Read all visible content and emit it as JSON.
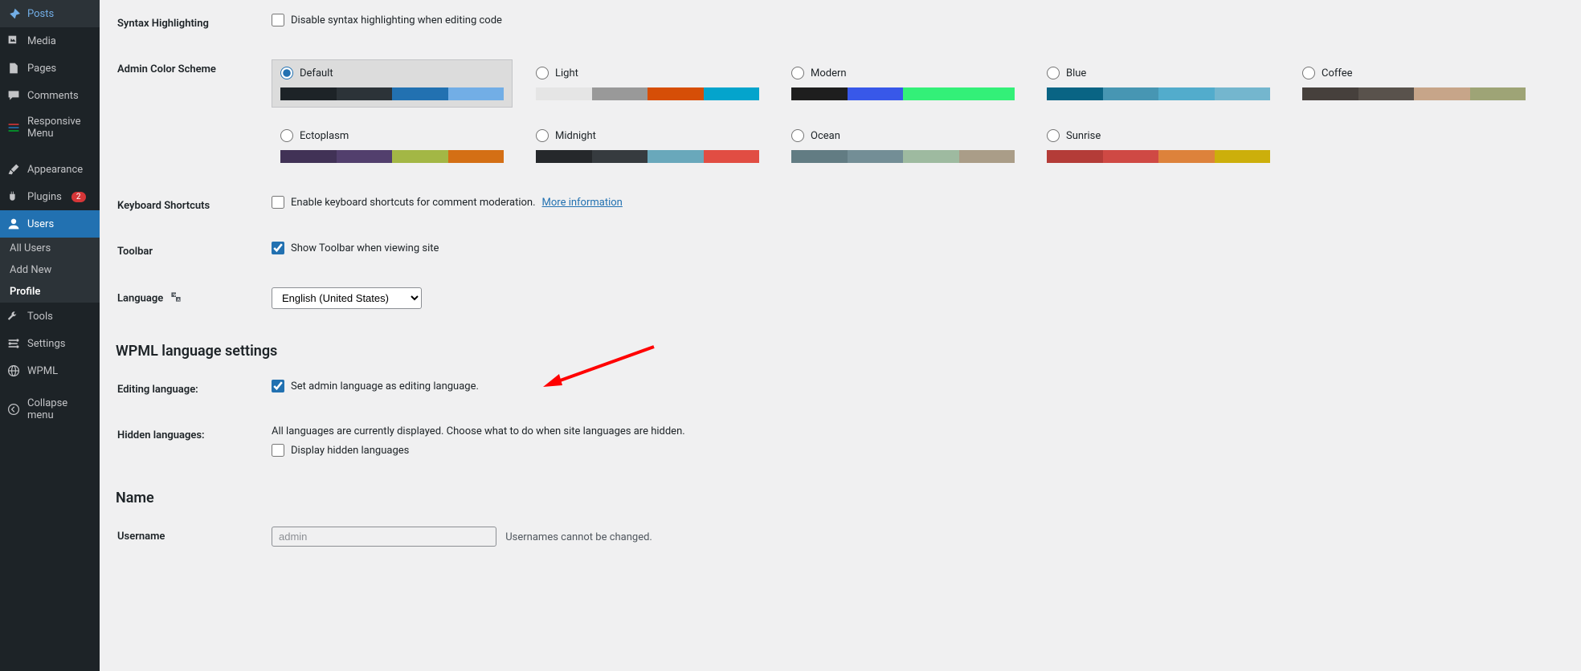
{
  "sidebar": {
    "items": [
      {
        "label": "Posts",
        "icon": "pin"
      },
      {
        "label": "Media",
        "icon": "media"
      },
      {
        "label": "Pages",
        "icon": "pages"
      },
      {
        "label": "Comments",
        "icon": "comment"
      },
      {
        "label": "Responsive Menu",
        "icon": "responsive"
      },
      {
        "label": "Appearance",
        "icon": "brush"
      },
      {
        "label": "Plugins",
        "icon": "plug",
        "badge": "2"
      },
      {
        "label": "Users",
        "icon": "user",
        "active": true
      },
      {
        "label": "Tools",
        "icon": "wrench"
      },
      {
        "label": "Settings",
        "icon": "gear"
      },
      {
        "label": "WPML",
        "icon": "globe"
      },
      {
        "label": "Collapse menu",
        "icon": "collapse"
      }
    ],
    "submenu": [
      {
        "label": "All Users"
      },
      {
        "label": "Add New"
      },
      {
        "label": "Profile",
        "active": true
      }
    ]
  },
  "rows": {
    "syntax": {
      "label": "Syntax Highlighting",
      "checkbox": "Disable syntax highlighting when editing code"
    },
    "colorScheme": {
      "label": "Admin Color Scheme"
    },
    "keyboard": {
      "label": "Keyboard Shortcuts",
      "checkbox": "Enable keyboard shortcuts for comment moderation.",
      "link": "More information"
    },
    "toolbar": {
      "label": "Toolbar",
      "checkbox": "Show Toolbar when viewing site"
    },
    "language": {
      "label": "Language",
      "select": "English (United States)"
    },
    "editingLang": {
      "label": "Editing language:",
      "checkbox": "Set admin language as editing language."
    },
    "hiddenLang": {
      "label": "Hidden languages:",
      "desc": "All languages are currently displayed. Choose what to do when site languages are hidden.",
      "checkbox": "Display hidden languages"
    },
    "username": {
      "label": "Username",
      "value": "admin",
      "desc": "Usernames cannot be changed."
    }
  },
  "headings": {
    "wpml": "WPML language settings",
    "name": "Name"
  },
  "schemes": [
    {
      "name": "Default",
      "selected": true,
      "colors": [
        "#1d2327",
        "#2c3338",
        "#2271b1",
        "#72aee6"
      ]
    },
    {
      "name": "Light",
      "colors": [
        "#e5e5e5",
        "#999999",
        "#d64e07",
        "#04a4cc"
      ]
    },
    {
      "name": "Modern",
      "colors": [
        "#1e1e1e",
        "#3858e9",
        "#33f078",
        "#33f078"
      ]
    },
    {
      "name": "Blue",
      "colors": [
        "#096484",
        "#4796b3",
        "#52accc",
        "#74B6CE"
      ]
    },
    {
      "name": "Coffee",
      "colors": [
        "#46403c",
        "#59524c",
        "#c7a589",
        "#9ea476"
      ]
    },
    {
      "name": "Ectoplasm",
      "colors": [
        "#413256",
        "#523f6d",
        "#a3b745",
        "#d46f15"
      ]
    },
    {
      "name": "Midnight",
      "colors": [
        "#25282b",
        "#363b3f",
        "#69a8bb",
        "#e14d43"
      ]
    },
    {
      "name": "Ocean",
      "colors": [
        "#627c83",
        "#738e96",
        "#9ebaa0",
        "#aa9d88"
      ]
    },
    {
      "name": "Sunrise",
      "colors": [
        "#b43c38",
        "#cf4944",
        "#dd823b",
        "#ccaf0b"
      ]
    }
  ]
}
